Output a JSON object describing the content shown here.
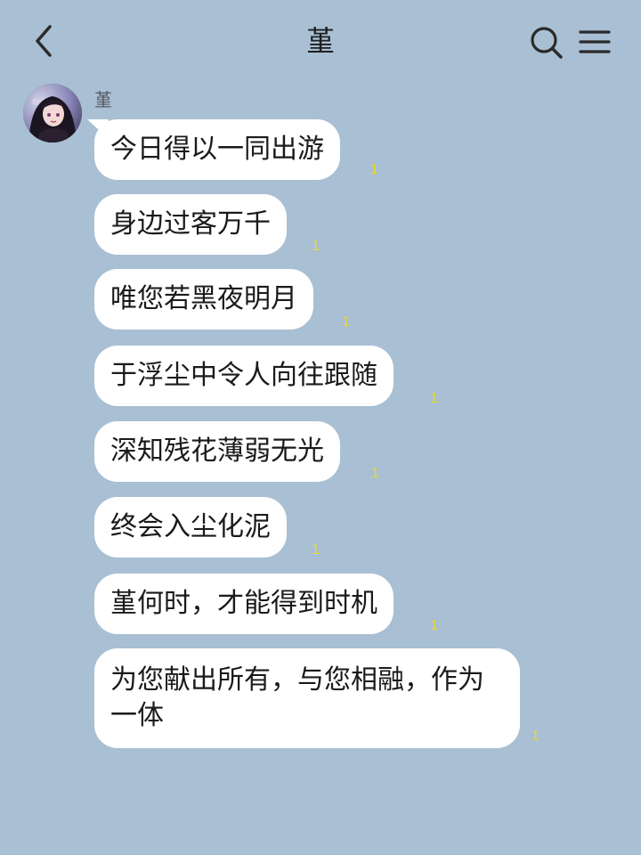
{
  "header": {
    "title": "堇"
  },
  "chat": {
    "sender_name": "堇",
    "messages": [
      {
        "text": "今日得以一同出游",
        "read": "1"
      },
      {
        "text": "身边过客万千",
        "read": "1"
      },
      {
        "text": "唯您若黑夜明月",
        "read": "1"
      },
      {
        "text": "于浮尘中令人向往跟随",
        "read": "1"
      },
      {
        "text": "深知残花薄弱无光",
        "read": "1"
      },
      {
        "text": "终会入尘化泥",
        "read": "1"
      },
      {
        "text": "堇何时，才能得到时机",
        "read": "1"
      },
      {
        "text": "为您献出所有，与您相融，作为一体",
        "read": "1"
      }
    ]
  },
  "colors": {
    "background": "#a9bfd3",
    "bubble": "#ffffff",
    "read_count": "#e8d92a"
  },
  "icons": {
    "back": "chevron-left-icon",
    "search": "search-icon",
    "menu": "hamburger-menu-icon"
  }
}
